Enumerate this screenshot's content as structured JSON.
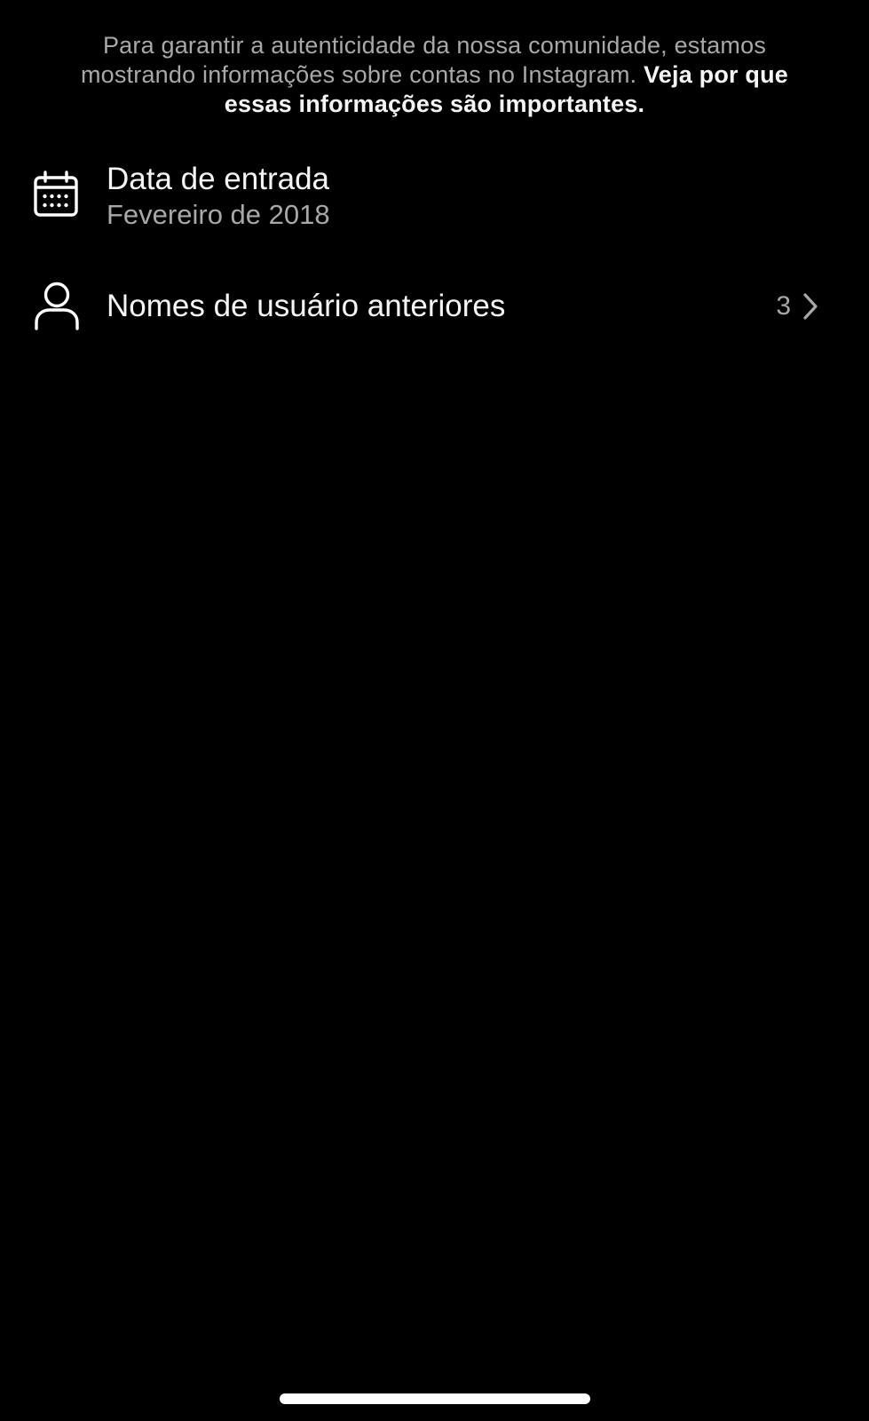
{
  "intro": {
    "text": "Para garantir a autenticidade da nossa comunidade, estamos mostrando informações sobre contas no Instagram.",
    "link": "Veja por que essas informações são importantes."
  },
  "rows": [
    {
      "icon": "calendar-icon",
      "title": "Data de entrada",
      "subtitle": "Fevereiro de 2018"
    },
    {
      "icon": "user-icon",
      "title": "Nomes de usuário anteriores",
      "count": "3",
      "trailing_icon": "chevron-right-icon"
    }
  ],
  "colors": {
    "background": "#000000",
    "primary_text": "#f5f5f5",
    "secondary_text": "#a8a8a8"
  }
}
